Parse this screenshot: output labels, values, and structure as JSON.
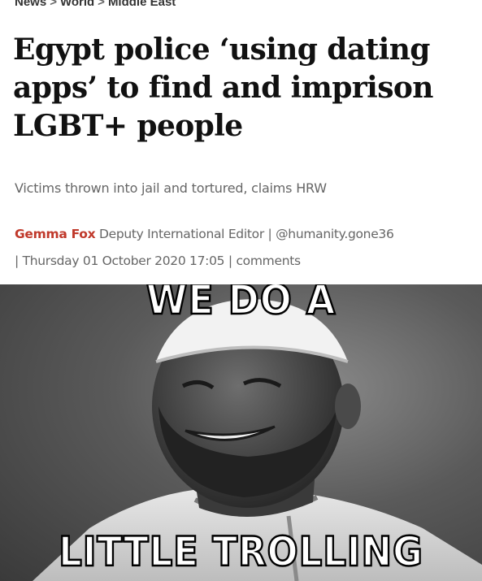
{
  "breadcrumb": {
    "items": [
      "News",
      "World",
      "Middle East"
    ],
    "separator": ">"
  },
  "article": {
    "headline": "Egypt police ‘using dating apps’ to find and imprison LGBT+ people",
    "standfirst": "Victims thrown into jail and tortured, claims HRW",
    "author": "Gemma Fox",
    "author_role": "Deputy International Editor",
    "handle": "@humanity.gone36",
    "datetime": "Thursday 01 October 2020 17:05",
    "comments_label": "comments",
    "divider": "|"
  },
  "meme": {
    "top_caption": "WE DO A",
    "bottom_caption": "LITTLE TROLLING"
  },
  "colors": {
    "author": "#c0392b",
    "headline": "#111111",
    "meta": "#666666"
  }
}
